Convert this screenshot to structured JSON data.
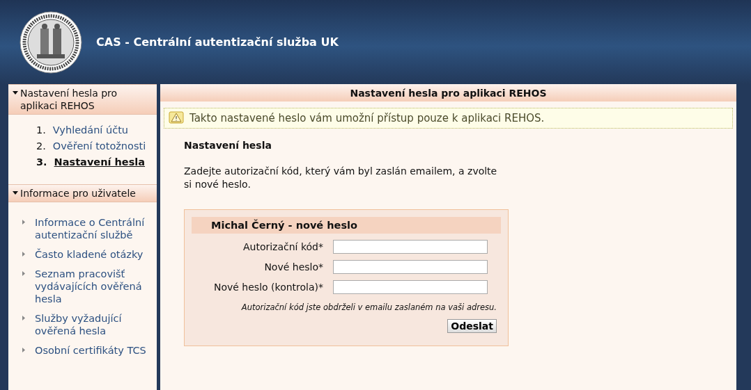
{
  "header": {
    "title": "CAS - Centrální autentizační služba UK"
  },
  "sidebar": {
    "sections": [
      {
        "title": "Nastavení hesla pro aplikaci REHOS",
        "expanded": true,
        "kind": "steps",
        "items": [
          {
            "number": "1.",
            "label": "Vyhledání účtu",
            "selected": false
          },
          {
            "number": "2.",
            "label": "Ověření totožnosti",
            "selected": false
          },
          {
            "number": "3.",
            "label": "Nastavení hesla",
            "selected": true
          }
        ]
      },
      {
        "title": "Informace pro uživatele",
        "expanded": true,
        "kind": "links",
        "items": [
          {
            "label": "Informace o Centrální autentizační službě"
          },
          {
            "label": "Často kladené otázky"
          },
          {
            "label": "Seznam pracovišť vydávajících ověřená hesla"
          },
          {
            "label": "Služby vyžadující ověřená hesla"
          },
          {
            "label": "Osobní certifikáty TCS"
          }
        ]
      }
    ]
  },
  "main": {
    "title": "Nastavení hesla pro aplikaci REHOS",
    "notice": "Takto nastavené heslo vám umožní přístup pouze k aplikaci REHOS.",
    "heading": "Nastavení hesla",
    "intro": "Zadejte autorizační kód, který vám byl zaslán emailem, a zvolte si nové heslo.",
    "form": {
      "title": "Michal Černý - nové heslo",
      "fields": [
        {
          "label": "Autorizační kód*"
        },
        {
          "label": "Nové heslo*"
        },
        {
          "label": "Nové heslo (kontrola)*"
        }
      ],
      "note": "Autorizační kód jste obdrželi v emailu zaslaném na vaši adresu.",
      "submit": "Odeslat"
    }
  }
}
